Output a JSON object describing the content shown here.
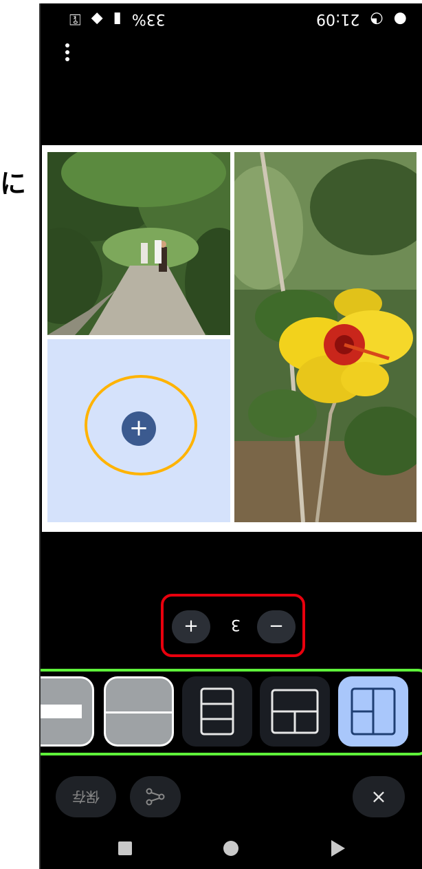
{
  "side_label": "に",
  "status_bar": {
    "time": "21:09",
    "battery": "33%"
  },
  "colors": {
    "accent_selected": "#a9c7fb",
    "empty_cell": "#d5e2fb",
    "add_button": "#3b5a8f",
    "annotation_orange": "#ffb300",
    "annotation_red": "#e8000d",
    "annotation_green": "#5ef13a"
  },
  "collage": {
    "add_label": "+",
    "photo_1": "forest-path-photo",
    "photo_2": "yellow-hibiscus-photo"
  },
  "counter": {
    "plus": "+",
    "value": "3",
    "minus": "−"
  },
  "layouts": [
    {
      "name": "clipped-layout",
      "selected": false
    },
    {
      "name": "two-horizontal",
      "selected": false
    },
    {
      "name": "three-vertical-stack",
      "selected": false
    },
    {
      "name": "one-top-two-bottom",
      "selected": false
    },
    {
      "name": "two-left-one-right",
      "selected": true
    }
  ],
  "bottom_actions": {
    "save_label": "保存",
    "share_icon": "share-icon",
    "close_label": "×"
  }
}
